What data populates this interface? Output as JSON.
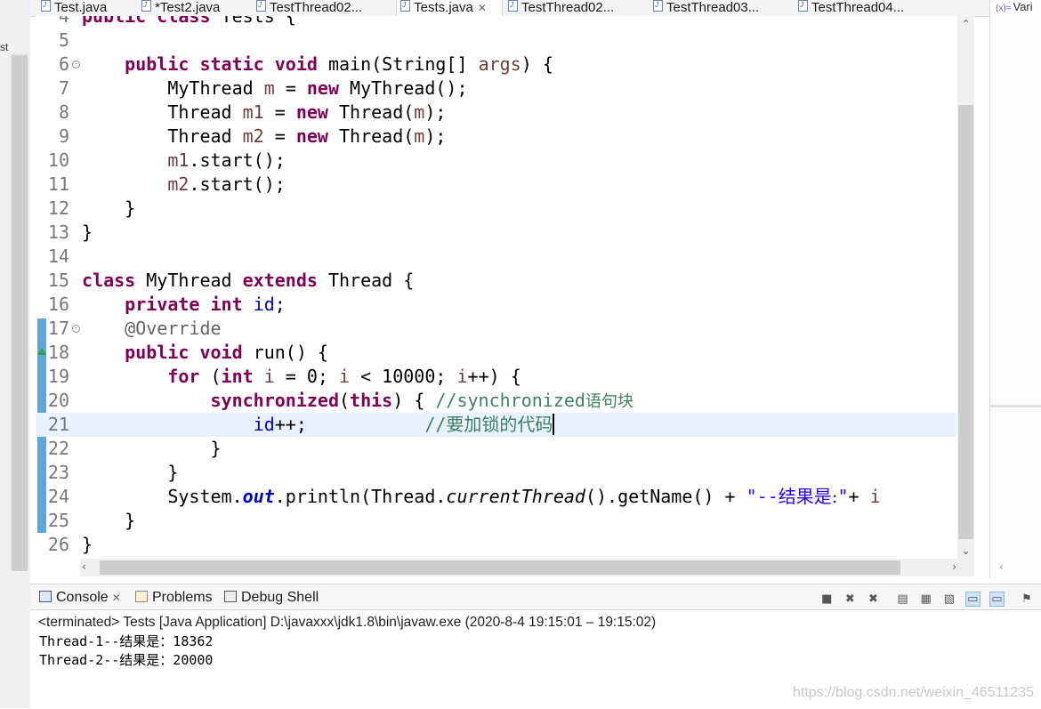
{
  "left_panel": {
    "fragment": "st"
  },
  "editor_tabs": [
    {
      "label": "Test.java",
      "active": false
    },
    {
      "label": "*Test2.java",
      "active": false
    },
    {
      "label": "TestThread02...",
      "active": false
    },
    {
      "label": "Tests.java",
      "active": true
    },
    {
      "label": "TestThread02...",
      "active": false
    },
    {
      "label": "TestThread03...",
      "active": false
    },
    {
      "label": "TestThread04...",
      "active": false
    }
  ],
  "right_panel": {
    "tab_label": "Vari",
    "tab_icon": "variables-icon"
  },
  "editor": {
    "file": "Tests.java",
    "current_line": 21,
    "lines": [
      {
        "n": "4",
        "text": "public class Tests {"
      },
      {
        "n": "5",
        "text": ""
      },
      {
        "n": "6",
        "text": "    public static void main(String[] args) {"
      },
      {
        "n": "7",
        "text": "        MyThread m = new MyThread();"
      },
      {
        "n": "8",
        "text": "        Thread m1 = new Thread(m);"
      },
      {
        "n": "9",
        "text": "        Thread m2 = new Thread(m);"
      },
      {
        "n": "10",
        "text": "        m1.start();"
      },
      {
        "n": "11",
        "text": "        m2.start();"
      },
      {
        "n": "12",
        "text": "    }"
      },
      {
        "n": "13",
        "text": "}"
      },
      {
        "n": "14",
        "text": ""
      },
      {
        "n": "15",
        "text": "class MyThread extends Thread {"
      },
      {
        "n": "16",
        "text": "    private int id;"
      },
      {
        "n": "17",
        "text": "    @Override"
      },
      {
        "n": "18",
        "text": "    public void run() {"
      },
      {
        "n": "19",
        "text": "        for (int i = 0; i < 10000; i++) {"
      },
      {
        "n": "20",
        "text": "            synchronized(this) { //synchronized语句块"
      },
      {
        "n": "21",
        "text": "                id++;           //要加锁的代码"
      },
      {
        "n": "22",
        "text": "            }"
      },
      {
        "n": "23",
        "text": "        }"
      },
      {
        "n": "24",
        "text": "        System.out.println(Thread.currentThread().getName() + \"--结果是:\"+ i"
      },
      {
        "n": "25",
        "text": "    }"
      },
      {
        "n": "26",
        "text": "}"
      }
    ]
  },
  "console": {
    "tabs": [
      {
        "label": "Console",
        "icon": "console-icon",
        "closable": true
      },
      {
        "label": "Problems",
        "icon": "problems-icon",
        "closable": false
      },
      {
        "label": "Debug Shell",
        "icon": "debug-shell-icon",
        "closable": false
      }
    ],
    "status": "<terminated> Tests [Java Application] D:\\javaxxx\\jdk1.8\\bin\\javaw.exe  (2020-8-4 19:15:01 – 19:15:02)",
    "output": [
      "Thread-1--结果是：18362",
      "Thread-2--结果是：20000"
    ],
    "toolbar": [
      "stop-icon",
      "remove-launch-icon",
      "remove-all-icon",
      "clear-console-icon",
      "scroll-lock-icon",
      "word-wrap-icon",
      "show-on-stdout-icon",
      "show-on-stderr-icon",
      "pin-console-icon"
    ]
  },
  "watermark": "https://blog.csdn.net/weixin_46511235"
}
